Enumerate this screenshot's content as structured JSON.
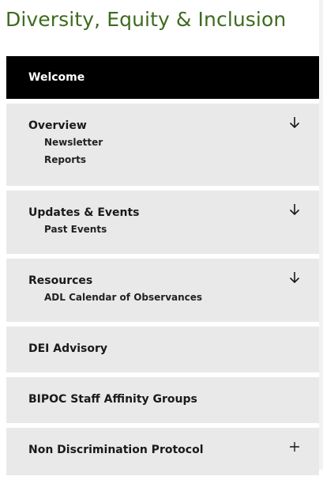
{
  "page": {
    "title": "Diversity, Equity & Inclusion"
  },
  "colors": {
    "title": "#3d6b1f",
    "active_bg": "#000000",
    "item_bg": "#e9e9e9"
  },
  "nav": {
    "welcome": {
      "label": "Welcome"
    },
    "overview": {
      "label": "Overview",
      "toggle_icon": "arrow-down-icon",
      "children": [
        "Newsletter",
        "Reports"
      ]
    },
    "updates": {
      "label": "Updates & Events",
      "toggle_icon": "arrow-down-icon",
      "children": [
        "Past Events"
      ]
    },
    "resources": {
      "label": "Resources",
      "toggle_icon": "arrow-down-icon",
      "children": [
        "ADL Calendar of Observances"
      ]
    },
    "dei_advisory": {
      "label": "DEI Advisory"
    },
    "bipoc": {
      "label": "BIPOC Staff Affinity Groups"
    },
    "non_discrimination": {
      "label": "Non Discrimination Protocol",
      "toggle_icon": "plus-icon"
    }
  }
}
